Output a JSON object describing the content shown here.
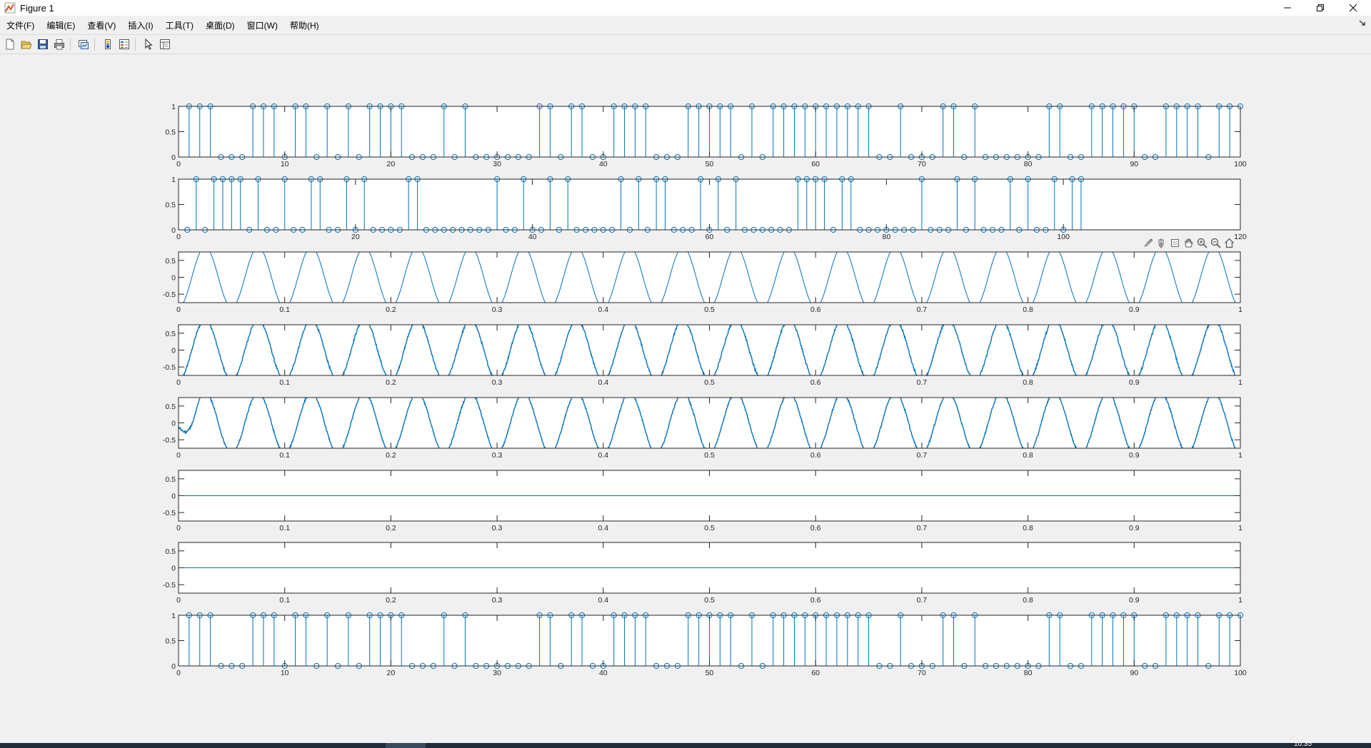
{
  "window": {
    "title": "Figure 1",
    "controls": [
      "minimize",
      "maximize",
      "close"
    ]
  },
  "menu": [
    "文件(F)",
    "编辑(E)",
    "查看(V)",
    "插入(I)",
    "工具(T)",
    "桌面(D)",
    "窗口(W)",
    "帮助(H)"
  ],
  "toolbar": {
    "groups": [
      [
        "new-figure-icon",
        "open-file-icon",
        "save-icon",
        "print-icon"
      ],
      [
        "link-plot-icon"
      ],
      [
        "colorbar-icon",
        "legend-icon"
      ],
      [
        "pointer-icon",
        "property-inspector-icon"
      ]
    ]
  },
  "axes_toolbar": [
    "brush-icon",
    "data-tips-icon",
    "datacursor-icon",
    "pan-icon",
    "zoom-in-icon",
    "zoom-out-icon",
    "home-icon"
  ],
  "colors": {
    "line": "#0072bd",
    "axis": "#262626",
    "figure_bg": "#f0f0f0",
    "axes_bg": "#ffffff"
  },
  "taskbar": {
    "clock": "10:35"
  },
  "chart_data": [
    {
      "type": "stem",
      "xlim": [
        0,
        100
      ],
      "ylim": [
        0,
        1
      ],
      "xticks": [
        0,
        10,
        20,
        30,
        40,
        50,
        60,
        70,
        80,
        90,
        100
      ],
      "xticklabels": [
        "0",
        "10",
        "20",
        "30",
        "40",
        "50",
        "60",
        "70",
        "80",
        "90",
        "100"
      ],
      "yticks": [
        0,
        0.5,
        1
      ],
      "yticklabels": [
        "0",
        "0.5",
        "1"
      ],
      "x_start": 1,
      "values": [
        1,
        1,
        1,
        0,
        0,
        0,
        1,
        1,
        1,
        0,
        1,
        1,
        0,
        1,
        0,
        1,
        0,
        1,
        1,
        1,
        1,
        0,
        0,
        0,
        1,
        0,
        1,
        0,
        0,
        0,
        0,
        0,
        0,
        1,
        1,
        0,
        1,
        1,
        0,
        0,
        1,
        1,
        1,
        1,
        0,
        0,
        0,
        1,
        1,
        1,
        1,
        1,
        0,
        1,
        0,
        1,
        1,
        1,
        1,
        1,
        1,
        1,
        1,
        1,
        1,
        0,
        0,
        1,
        0,
        0,
        0,
        1,
        1,
        0,
        1,
        0,
        0,
        0,
        0,
        0,
        0,
        1,
        1,
        0,
        0,
        1,
        1,
        1,
        1,
        1,
        0,
        0,
        1,
        1,
        1,
        1,
        0,
        1,
        1,
        1
      ]
    },
    {
      "type": "stem",
      "xlim": [
        0,
        120
      ],
      "ylim": [
        0,
        1
      ],
      "xticks": [
        0,
        20,
        40,
        60,
        80,
        100,
        120
      ],
      "xticklabels": [
        "0",
        "20",
        "40",
        "60",
        "80",
        "100",
        "120"
      ],
      "yticks": [
        0,
        0.5,
        1
      ],
      "yticklabels": [
        "0",
        "0.5",
        "1"
      ],
      "x_start": 1,
      "values": [
        0,
        1,
        0,
        1,
        1,
        1,
        1,
        0,
        1,
        0,
        0,
        1,
        0,
        0,
        1,
        1,
        0,
        0,
        1,
        0,
        1,
        0,
        0,
        0,
        0,
        1,
        1,
        0,
        0,
        0,
        0,
        0,
        0,
        0,
        0,
        1,
        0,
        0,
        1,
        0,
        0,
        1,
        0,
        1,
        0,
        0,
        0,
        0,
        0,
        1,
        0,
        1,
        0,
        1,
        1,
        0,
        0,
        0,
        1,
        0,
        1,
        0,
        1,
        0,
        0,
        0,
        0,
        0,
        0,
        1,
        1,
        1,
        1,
        0,
        1,
        1,
        0,
        0,
        0,
        0,
        0,
        0,
        0,
        1,
        0,
        0,
        0,
        1,
        0,
        1,
        0,
        0,
        0,
        1,
        0,
        1,
        0,
        0,
        1,
        0,
        1,
        1
      ]
    },
    {
      "type": "line",
      "series": "cosine",
      "cycles": 20,
      "amplitude": 0.9,
      "phase": 3.14159,
      "noise": 0,
      "xlim": [
        0,
        1
      ],
      "ylim": [
        -0.75,
        0.75
      ],
      "xticks": [
        0,
        0.1,
        0.2,
        0.3,
        0.4,
        0.5,
        0.6,
        0.7,
        0.8,
        0.9,
        1
      ],
      "xticklabels": [
        "0",
        "0.1",
        "0.2",
        "0.3",
        "0.4",
        "0.5",
        "0.6",
        "0.7",
        "0.8",
        "0.9",
        "1"
      ],
      "yticks": [
        -0.5,
        0,
        0.5
      ],
      "yticklabels": [
        "-0.5",
        "0",
        "0.5"
      ]
    },
    {
      "type": "line",
      "series": "cosine",
      "cycles": 20,
      "amplitude": 0.9,
      "phase": 3.14159,
      "noise": 0.035,
      "xlim": [
        0,
        1
      ],
      "ylim": [
        -0.75,
        0.75
      ],
      "xticks": [
        0,
        0.1,
        0.2,
        0.3,
        0.4,
        0.5,
        0.6,
        0.7,
        0.8,
        0.9,
        1
      ],
      "xticklabels": [
        "0",
        "0.1",
        "0.2",
        "0.3",
        "0.4",
        "0.5",
        "0.6",
        "0.7",
        "0.8",
        "0.9",
        "1"
      ],
      "yticks": [
        -0.5,
        0,
        0.5
      ],
      "yticklabels": [
        "-0.5",
        "0",
        "0.5"
      ]
    },
    {
      "type": "line",
      "series": "cosine",
      "cycles": 20,
      "amplitude": 0.9,
      "phase": 3.14159,
      "noise": 0.03,
      "onset": 0.02,
      "xlim": [
        0,
        1
      ],
      "ylim": [
        -0.75,
        0.75
      ],
      "xticks": [
        0,
        0.1,
        0.2,
        0.3,
        0.4,
        0.5,
        0.6,
        0.7,
        0.8,
        0.9,
        1
      ],
      "xticklabels": [
        "0",
        "0.1",
        "0.2",
        "0.3",
        "0.4",
        "0.5",
        "0.6",
        "0.7",
        "0.8",
        "0.9",
        "1"
      ],
      "yticks": [
        -0.5,
        0,
        0.5
      ],
      "yticklabels": [
        "-0.5",
        "0",
        "0.5"
      ]
    },
    {
      "type": "line",
      "series": "constant",
      "value": 0,
      "xlim": [
        0,
        1
      ],
      "ylim": [
        -0.75,
        0.75
      ],
      "xticks": [
        0,
        0.1,
        0.2,
        0.3,
        0.4,
        0.5,
        0.6,
        0.7,
        0.8,
        0.9,
        1
      ],
      "xticklabels": [
        "0",
        "0.1",
        "0.2",
        "0.3",
        "0.4",
        "0.5",
        "0.6",
        "0.7",
        "0.8",
        "0.9",
        "1"
      ],
      "yticks": [
        -0.5,
        0,
        0.5
      ],
      "yticklabels": [
        "-0.5",
        "0",
        "0.5"
      ]
    },
    {
      "type": "line",
      "series": "constant",
      "value": 0,
      "xlim": [
        0,
        1
      ],
      "ylim": [
        -0.75,
        0.75
      ],
      "xticks": [
        0,
        0.1,
        0.2,
        0.3,
        0.4,
        0.5,
        0.6,
        0.7,
        0.8,
        0.9,
        1
      ],
      "xticklabels": [
        "0",
        "0.1",
        "0.2",
        "0.3",
        "0.4",
        "0.5",
        "0.6",
        "0.7",
        "0.8",
        "0.9",
        "1"
      ],
      "yticks": [
        -0.5,
        0,
        0.5
      ],
      "yticklabels": [
        "-0.5",
        "0",
        "0.5"
      ]
    },
    {
      "type": "stem",
      "xlim": [
        0,
        100
      ],
      "ylim": [
        0,
        1
      ],
      "xticks": [
        0,
        10,
        20,
        30,
        40,
        50,
        60,
        70,
        80,
        90,
        100
      ],
      "xticklabels": [
        "0",
        "10",
        "20",
        "30",
        "40",
        "50",
        "60",
        "70",
        "80",
        "90",
        "100"
      ],
      "yticks": [
        0,
        0.5,
        1
      ],
      "yticklabels": [
        "0",
        "0.5",
        "1"
      ],
      "x_start": 1,
      "values": [
        1,
        1,
        1,
        0,
        0,
        0,
        1,
        1,
        1,
        0,
        1,
        1,
        0,
        1,
        0,
        1,
        0,
        1,
        1,
        1,
        1,
        0,
        0,
        0,
        1,
        0,
        1,
        0,
        0,
        0,
        0,
        0,
        0,
        1,
        1,
        0,
        1,
        1,
        0,
        0,
        1,
        1,
        1,
        1,
        0,
        0,
        0,
        1,
        1,
        1,
        1,
        1,
        0,
        1,
        0,
        1,
        1,
        1,
        1,
        1,
        1,
        1,
        1,
        1,
        1,
        0,
        0,
        1,
        0,
        0,
        0,
        1,
        1,
        0,
        1,
        0,
        0,
        0,
        0,
        0,
        0,
        1,
        1,
        0,
        0,
        1,
        1,
        1,
        1,
        1,
        0,
        0,
        1,
        1,
        1,
        1,
        0,
        1,
        1,
        1
      ]
    }
  ]
}
